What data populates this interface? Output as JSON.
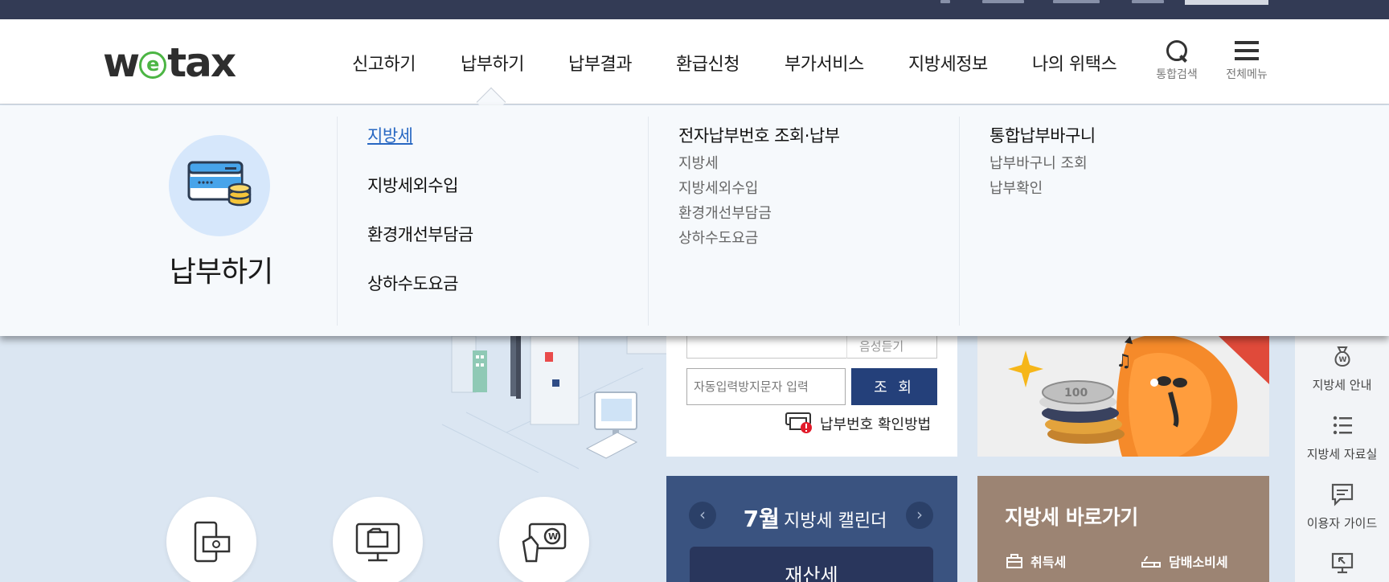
{
  "header": {
    "logo": {
      "pre": "w",
      "mid": "e",
      "post": "tax"
    },
    "nav": [
      {
        "label": "신고하기"
      },
      {
        "label": "납부하기"
      },
      {
        "label": "납부결과"
      },
      {
        "label": "환급신청"
      },
      {
        "label": "부가서비스"
      },
      {
        "label": "지방세정보"
      },
      {
        "label": "나의 위택스"
      }
    ],
    "search_label": "통합검색",
    "menu_label": "전체메뉴"
  },
  "mega_menu": {
    "title": "납부하기",
    "col1": [
      {
        "label": "지방세",
        "active": true
      },
      {
        "label": "지방세외수입"
      },
      {
        "label": "환경개선부담금"
      },
      {
        "label": "상하수도요금"
      }
    ],
    "col2": {
      "title": "전자납부번호 조회·납부",
      "items": [
        "지방세",
        "지방세외수입",
        "환경개선부담금",
        "상하수도요금"
      ]
    },
    "col3": {
      "title": "통합납부바구니",
      "items": [
        "납부바구니 조회",
        "납부확인"
      ]
    }
  },
  "payment_lookup": {
    "ghost_text": "음성듣기",
    "captcha_placeholder": "자동입력방지문자 입력",
    "query_button": "조 회",
    "howto_label": "납부번호 확인방법"
  },
  "calendar": {
    "month": "7월",
    "title": "지방세 캘린더",
    "prev": "‹",
    "next": "›",
    "event": "재산세"
  },
  "shortcut": {
    "title": "지방세 바로가기",
    "links": [
      "취득세",
      "담배소비세"
    ]
  },
  "sidebar": {
    "items": [
      "지방세 안내",
      "지방세 자료실",
      "이용자 가이드"
    ]
  },
  "colors": {
    "topbar": "#333b55",
    "accent_blue": "#2767c2",
    "query_button": "#24407a",
    "calendar_bg": "#3a5380",
    "shortcut_bg": "#9c8473",
    "logo_green": "#4cb544"
  }
}
